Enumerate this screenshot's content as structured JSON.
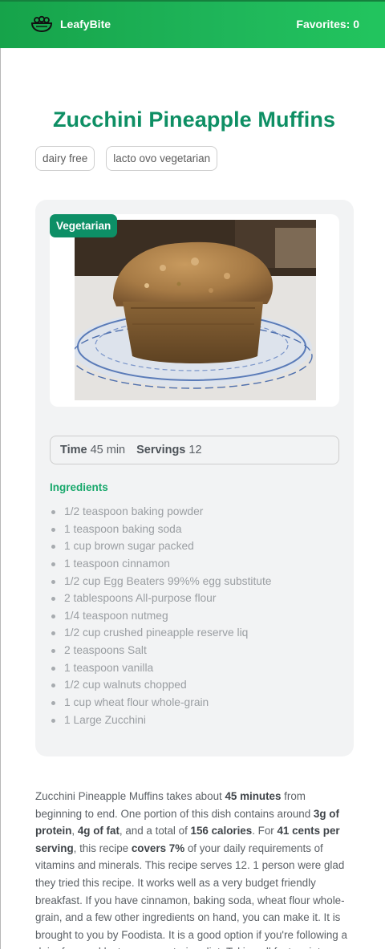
{
  "header": {
    "brand": "LeafyBite",
    "brand_icon": "salad-bowl-icon",
    "favorites_label": "Favorites: 0"
  },
  "recipe": {
    "title": "Zucchini Pineapple Muffins",
    "tags": [
      "dairy free",
      "lacto ovo vegetarian"
    ],
    "badge": "Vegetarian",
    "time_label": "Time",
    "time_value": "45 min",
    "servings_label": "Servings",
    "servings_value": "12",
    "ingredients_heading": "Ingredients",
    "ingredients": [
      "1/2 teaspoon baking powder",
      "1 teaspoon baking soda",
      "1 cup brown sugar packed",
      "1 teaspoon cinnamon",
      "1/2 cup Egg Beaters 99%% egg substitute",
      "2 tablespoons All-purpose flour",
      "1/4 teaspoon nutmeg",
      "1/2 cup crushed pineapple reserve liq",
      "2 teaspoons Salt",
      "1 teaspoon vanilla",
      "1/2 cup walnuts chopped",
      "1 cup wheat flour whole-grain",
      "1 Large Zucchini"
    ]
  },
  "summary": {
    "p1": "Zucchini Pineapple Muffins takes about ",
    "b1": "45 minutes",
    "p2": " from beginning to end. One portion of this dish contains around ",
    "b2": "3g of protein",
    "p3": ", ",
    "b3": "4g of fat",
    "p4": ", and a total of ",
    "b4": "156 calories",
    "p5": ". For ",
    "b5": "41 cents per serving",
    "p6": ", this recipe ",
    "b6": "covers 7%",
    "p7": " of your daily requirements of vitamins and minerals. This recipe serves 12. 1 person were glad they tried this recipe. It works well as a very budget friendly breakfast. If you have cinnamon, baking soda, wheat flour whole-grain, and a few other ingredients on hand, you can make it. It is brought to you by Foodista. It is a good option if you're following a dairy free and lacto ovo vegetarian diet. Taking all factors into"
  }
}
